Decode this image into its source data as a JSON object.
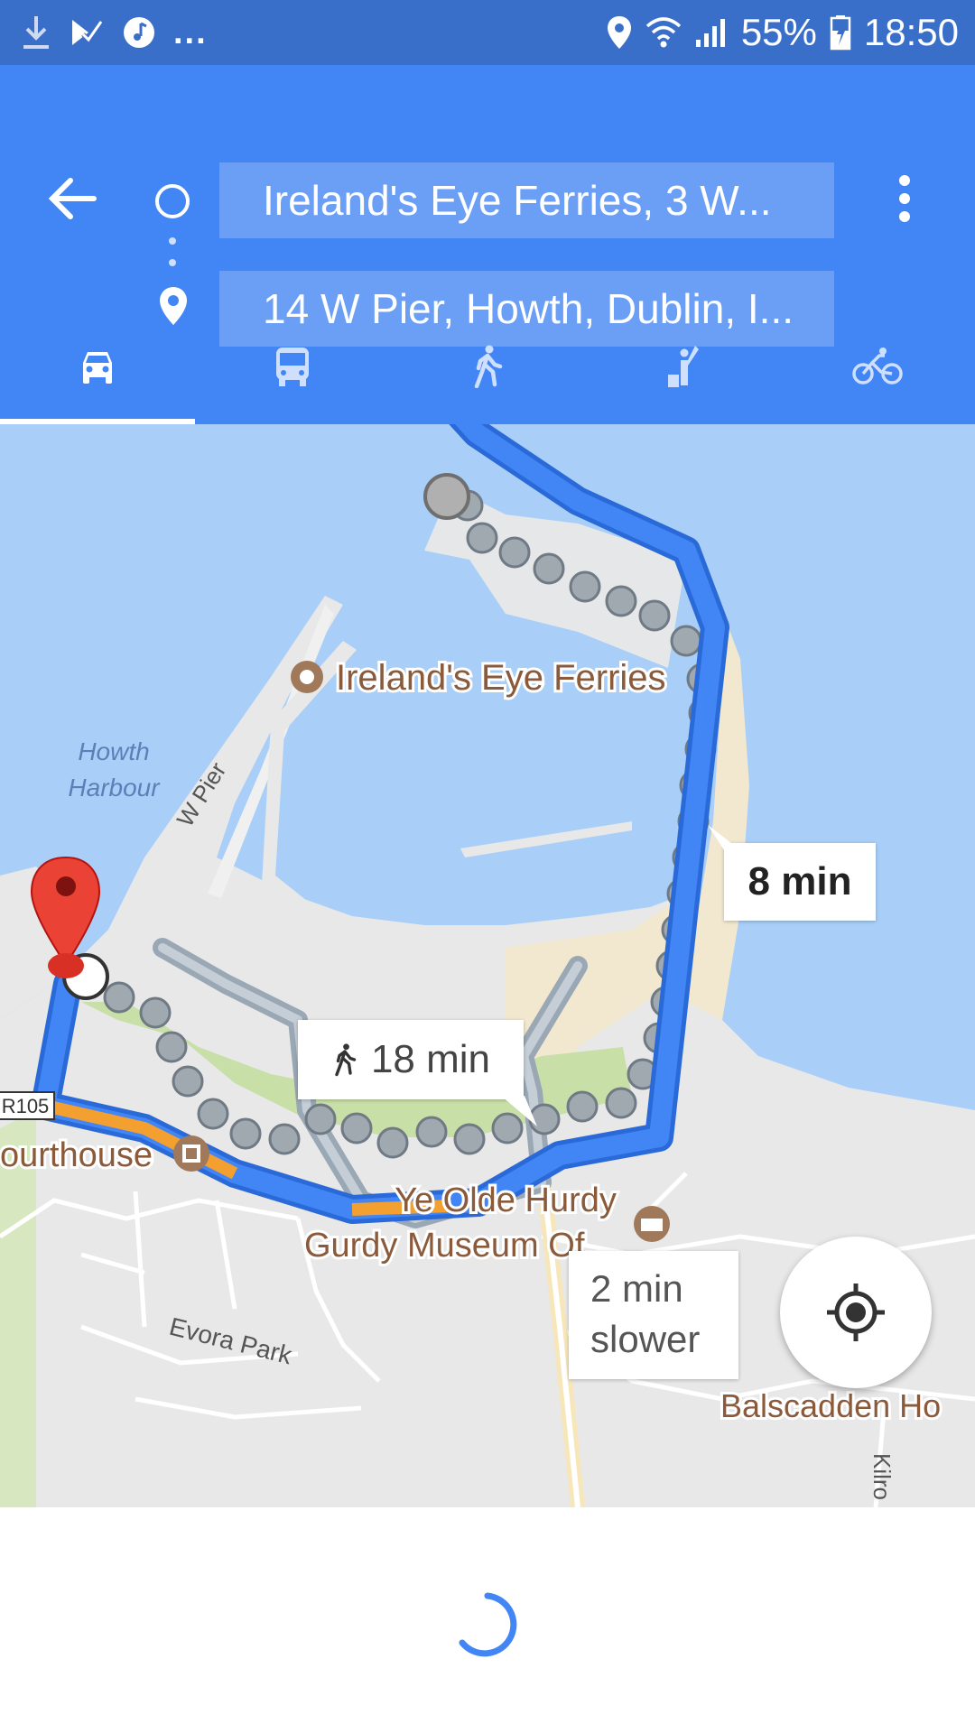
{
  "status_bar": {
    "overflow": "...",
    "battery": "55%",
    "time": "18:50",
    "icons": [
      "download-icon",
      "check-icon",
      "music-icon",
      "location-icon",
      "wifi-icon",
      "signal-icon",
      "battery-icon"
    ]
  },
  "directions": {
    "origin": "Ireland's Eye Ferries, 3 W...",
    "destination": "14 W Pier, Howth, Dublin, I..."
  },
  "tabs": [
    {
      "name": "drive",
      "icon": "car-icon",
      "selected": true
    },
    {
      "name": "transit",
      "icon": "bus-icon",
      "selected": false
    },
    {
      "name": "walk",
      "icon": "walk-icon",
      "selected": false
    },
    {
      "name": "ride",
      "icon": "hail-icon",
      "selected": false
    },
    {
      "name": "bike",
      "icon": "bike-icon",
      "selected": false
    }
  ],
  "map": {
    "labels": {
      "ferries": "Ireland's Eye Ferries",
      "harbour_line1": "Howth",
      "harbour_line2": "Harbour",
      "w_pier": "W Pier",
      "courthouse": "ourthouse",
      "museum_line1": "Ye Olde Hurdy",
      "museum_line2": "Gurdy Museum Of...",
      "evora": "Evora Park",
      "balscadden": "Balscadden Ho",
      "kilro": "Kilro",
      "road": "R105"
    },
    "route_bubbles": {
      "drive": "8 min",
      "walk": "18 min",
      "alt_line1": "2 min",
      "alt_line2": "slower"
    }
  },
  "colors": {
    "status_bar": "#3a6fc9",
    "app_bar": "#4285f4",
    "route": "#4285f4",
    "traffic": "#f4a030",
    "water": "#a9cff8",
    "land": "#e8e8e8",
    "park": "#c8e0a8"
  }
}
